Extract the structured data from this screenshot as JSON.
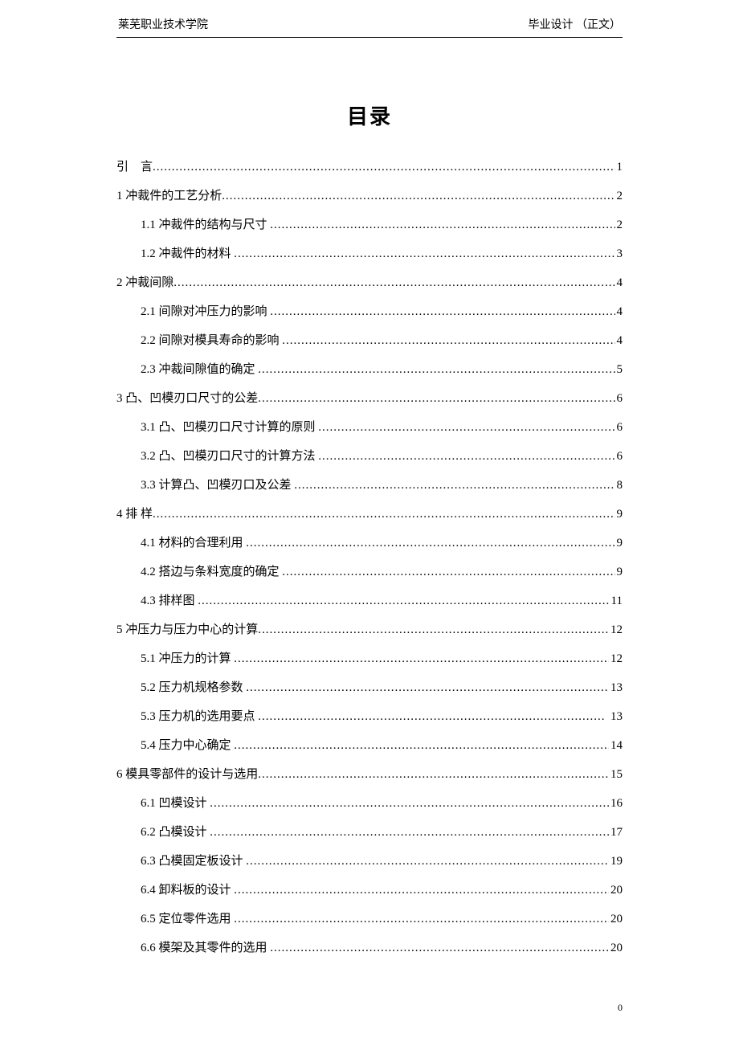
{
  "header": {
    "left": "莱芜职业技术学院",
    "right": "毕业设计 （正文）"
  },
  "title": "目录",
  "footer_page": "0",
  "toc": [
    {
      "level": 0,
      "label": "引    言",
      "page": "1"
    },
    {
      "level": 0,
      "label": "1 冲裁件的工艺分析",
      "page": "2"
    },
    {
      "level": 1,
      "label": "1.1 冲裁件的结构与尺寸 ",
      "page": "2"
    },
    {
      "level": 1,
      "label": "1.2 冲裁件的材料 ",
      "page": "3"
    },
    {
      "level": 0,
      "label": "2 冲裁间隙",
      "page": "4"
    },
    {
      "level": 1,
      "label": "2.1 间隙对冲压力的影响 ",
      "page": "4"
    },
    {
      "level": 1,
      "label": "2.2 间隙对模具寿命的影响 ",
      "page": "4"
    },
    {
      "level": 1,
      "label": "2.3 冲裁间隙值的确定 ",
      "page": "5"
    },
    {
      "level": 0,
      "label": "3 凸、凹模刃口尺寸的公差",
      "page": "6"
    },
    {
      "level": 1,
      "label": "3.1 凸、凹模刃口尺寸计算的原则 ",
      "page": "6"
    },
    {
      "level": 1,
      "label": "3.2 凸、凹模刃口尺寸的计算方法 ",
      "page": "6"
    },
    {
      "level": 1,
      "label": "3.3 计算凸、凹模刃口及公差 ",
      "page": "8"
    },
    {
      "level": 0,
      "label": "4 排 样",
      "page": "9"
    },
    {
      "level": 1,
      "label": "4.1 材料的合理利用 ",
      "page": "9"
    },
    {
      "level": 1,
      "label": "4.2 搭边与条料宽度的确定 ",
      "page": "9"
    },
    {
      "level": 1,
      "label": "4.3 排样图 ",
      "page": "11"
    },
    {
      "level": 0,
      "label": "5 冲压力与压力中心的计算",
      "page": "12"
    },
    {
      "level": 1,
      "label": "5.1 冲压力的计算 ",
      "page": "12"
    },
    {
      "level": 1,
      "label": "5.2 压力机规格参数 ",
      "page": "13"
    },
    {
      "level": 1,
      "label": "5.3 压力机的选用要点 ",
      "page": " 13"
    },
    {
      "level": 1,
      "label": "5.4 压力中心确定 ",
      "page": "14"
    },
    {
      "level": 0,
      "label": "6 模具零部件的设计与选用",
      "page": "15"
    },
    {
      "level": 1,
      "label": "6.1 凹模设计 ",
      "page": "16"
    },
    {
      "level": 1,
      "label": "6.2 凸模设计 ",
      "page": "17"
    },
    {
      "level": 1,
      "label": "6.3 凸模固定板设计 ",
      "page": "19"
    },
    {
      "level": 1,
      "label": "6.4 卸料板的设计 ",
      "page": "20"
    },
    {
      "level": 1,
      "label": "6.5 定位零件选用 ",
      "page": "20"
    },
    {
      "level": 1,
      "label": "6.6 模架及其零件的选用 ",
      "page": "20"
    }
  ]
}
